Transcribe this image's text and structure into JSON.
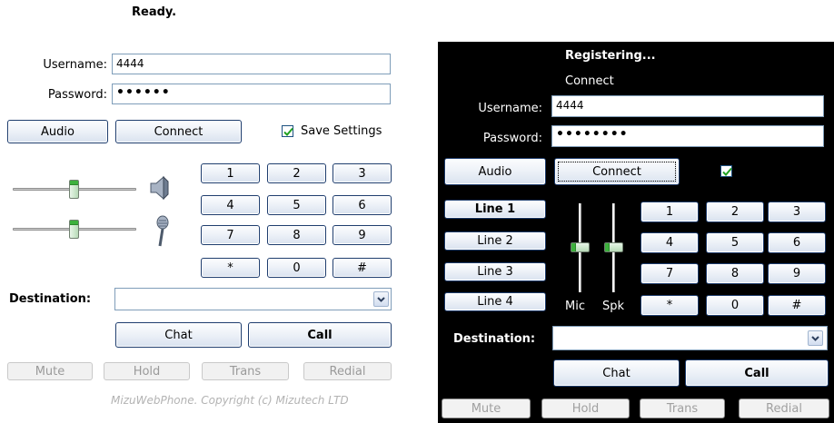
{
  "left": {
    "status": "Ready.",
    "username_label": "Username:",
    "username_value": "4444",
    "password_label": "Password:",
    "password_value": "••••••",
    "audio_button": "Audio",
    "connect_button": "Connect",
    "save_settings_label": "Save Settings",
    "save_settings_checked": true,
    "dialpad": [
      "1",
      "2",
      "3",
      "4",
      "5",
      "6",
      "7",
      "8",
      "9",
      "*",
      "0",
      "#"
    ],
    "destination_label": "Destination:",
    "destination_value": "",
    "chat_button": "Chat",
    "call_button": "Call",
    "mute_button": "Mute",
    "hold_button": "Hold",
    "trans_button": "Trans",
    "redial_button": "Redial",
    "copyright": "MizuWebPhone. Copyright (c) Mizutech LTD"
  },
  "right": {
    "status": "Registering...",
    "sub_status": "Connect",
    "username_label": "Username:",
    "username_value": "4444",
    "password_label": "Password:",
    "password_value": "••••••••",
    "audio_button": "Audio",
    "connect_button": "Connect",
    "save_checked": true,
    "lines": [
      "Line 1",
      "Line 2",
      "Line 3",
      "Line 4"
    ],
    "mic_label": "Mic",
    "spk_label": "Spk",
    "dialpad": [
      "1",
      "2",
      "3",
      "4",
      "5",
      "6",
      "7",
      "8",
      "9",
      "*",
      "0",
      "#"
    ],
    "destination_label": "Destination:",
    "destination_value": "",
    "chat_button": "Chat",
    "call_button": "Call",
    "mute_button": "Mute",
    "hold_button": "Hold",
    "trans_button": "Trans",
    "redial_button": "Redial"
  },
  "colors": {
    "button_border": "#1e3d6e",
    "field_border": "#7f9db9",
    "slider_thumb_accent": "#3db13d",
    "dark_background": "#000000",
    "check_mark": "#21a121"
  },
  "icons": {
    "speaker": "speaker-icon",
    "microphone": "microphone-icon",
    "dropdown": "chevron-down-icon",
    "check": "checkmark-icon"
  },
  "levels": {
    "left_speaker_volume": 0.5,
    "left_mic_volume": 0.5,
    "right_mic_volume": 0.5,
    "right_speaker_volume": 0.5
  }
}
